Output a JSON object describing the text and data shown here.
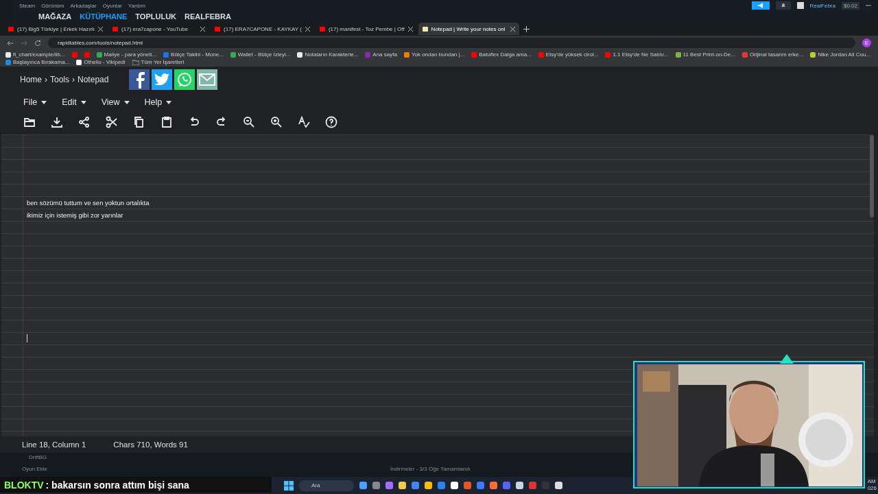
{
  "steam": {
    "menu": [
      "Steam",
      "Görünüm",
      "Arkadaşlar",
      "Oyunlar",
      "Yardım"
    ],
    "nav": [
      {
        "label": "MAĞAZA",
        "selected": false
      },
      {
        "label": "KÜTÜPHANE",
        "selected": true
      },
      {
        "label": "TOPLULUK",
        "selected": false
      },
      {
        "label": "REALFEBRA",
        "selected": false
      }
    ],
    "user": "RealFebra",
    "balance": "$0.02",
    "bottom_item": "DriftBG",
    "add_game": "Oyun Ekle",
    "downloads": "İndirmeler - 3/3 Öğe Tamamlandı"
  },
  "browser": {
    "tabs": [
      {
        "label": "(17) Big5 Türkiye | Erkek Hazırlı",
        "selected": false,
        "color": "#ff0000"
      },
      {
        "label": "(17) era7capone - YouTube",
        "selected": false,
        "color": "#ff0000"
      },
      {
        "label": "(17) ERA7CAPONE - KAYKAY (",
        "selected": false,
        "color": "#ff0000"
      },
      {
        "label": "(17) manifest - Toz Pembe | Off",
        "selected": false,
        "color": "#ff0000"
      },
      {
        "label": "Notepad | Write your notes onl",
        "selected": true,
        "color": "#f3e9b0"
      }
    ],
    "address": "rapidtables.com/tools/notepad.html",
    "profile": "E",
    "bookmarks": [
      {
        "label": "fl_chart/example/lib...",
        "color": "#e8eaed"
      },
      {
        "color": "#ff0000"
      },
      {
        "color": "#ff0000"
      },
      {
        "label": "Maliye - para yöneti...",
        "color": "#34a853"
      },
      {
        "label": "Bütçe Takibi - Mone...",
        "color": "#1a73e8"
      },
      {
        "label": "Wallet - Bütçe İzleyi...",
        "color": "#34a853"
      },
      {
        "label": "Notaların Karakterle...",
        "color": "#e8eaed"
      },
      {
        "label": "Ana sayfa",
        "color": "#8e24aa"
      },
      {
        "label": "Yok ondan bundan |...",
        "color": "#f57c00"
      },
      {
        "label": "Batuflex Dalga ama...",
        "color": "#ff0000"
      },
      {
        "label": "Etsy'de yüksek cirol...",
        "color": "#ff0000"
      },
      {
        "label": "1.1 Etsy'de Ne Satılır...",
        "color": "#ff0000"
      },
      {
        "label": "11 Best Print-on-De...",
        "color": "#7cb342"
      },
      {
        "label": "Orijinal tasarım erke...",
        "color": "#e53935"
      },
      {
        "label": "Nike Jordan All Cou...",
        "color": "#c0ca33"
      },
      {
        "label": "Başlayınca Bırakama...",
        "color": "#1e88e5"
      },
      {
        "label": "Othello - Vikipedi",
        "color": "#ffffff"
      }
    ],
    "all_bookmarks": "Tüm Yer İşaretleri"
  },
  "page": {
    "breadcrumb": [
      "Home",
      "›",
      "Tools",
      "›",
      "Notepad"
    ],
    "menus": [
      "File",
      "Edit",
      "View",
      "Help"
    ],
    "notepad": {
      "lines": [
        "ben sözümü tuttum ve sen yoktun ortalıkta",
        "ikimiz için istemiş gibi zor yarınlar"
      ]
    },
    "status": {
      "position": "Line 18, Column 1",
      "counts": "Chars 710, Words 91"
    }
  },
  "chat": {
    "user": "BLOKTV",
    "message": ": bakarsın sonra attım bişi sana"
  },
  "taskbar": {
    "search": "Ara",
    "clock": [
      "AM",
      "026"
    ]
  }
}
